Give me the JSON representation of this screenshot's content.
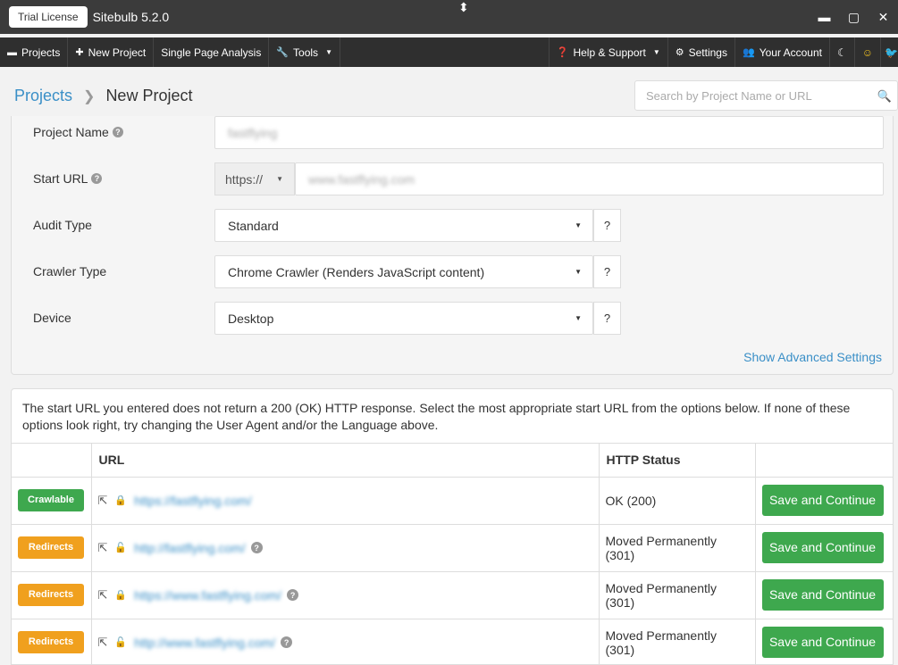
{
  "titlebar": {
    "license": "Trial License",
    "title": "Sitebulb 5.2.0"
  },
  "menu": {
    "projects": "Projects",
    "new_project": "New Project",
    "single_page": "Single Page Analysis",
    "tools": "Tools",
    "help": "Help & Support",
    "settings": "Settings",
    "account": "Your Account"
  },
  "breadcrumb": {
    "root": "Projects",
    "current": "New Project"
  },
  "search": {
    "placeholder": "Search by Project Name or URL"
  },
  "form": {
    "project_name_label": "Project Name",
    "project_name_value": "fastflying",
    "start_url_label": "Start URL",
    "protocol": "https://",
    "start_url_value": "www.fastflying.com",
    "audit_type_label": "Audit Type",
    "audit_type_value": "Standard",
    "crawler_type_label": "Crawler Type",
    "crawler_type_value": "Chrome Crawler (Renders JavaScript content)",
    "device_label": "Device",
    "device_value": "Desktop",
    "help_button": "?",
    "advanced_link": "Show Advanced Settings"
  },
  "results": {
    "notice": "The start URL you entered does not return a 200 (OK) HTTP response. Select the most appropriate start URL from the options below. If none of these options look right, try changing the User Agent and/or the Language above.",
    "headers": [
      "",
      "URL",
      "HTTP Status",
      ""
    ],
    "rows": [
      {
        "badge": "Crawlable",
        "url": "https://fastflying.com/",
        "status": "OK (200)",
        "action": "Save and Continue"
      },
      {
        "badge": "Redirects",
        "url": "http://fastflying.com/",
        "status": "Moved Permanently (301)",
        "action": "Save and Continue"
      },
      {
        "badge": "Redirects",
        "url": "https://www.fastflying.com/",
        "status": "Moved Permanently (301)",
        "action": "Save and Continue"
      },
      {
        "badge": "Redirects",
        "url": "http://www.fastflying.com/",
        "status": "Moved Permanently (301)",
        "action": "Save and Continue"
      }
    ]
  },
  "colors": {
    "accent": "#3a8fc7",
    "success": "#3ea84e",
    "warning": "#f0a01e",
    "danger": "#d9534f"
  }
}
